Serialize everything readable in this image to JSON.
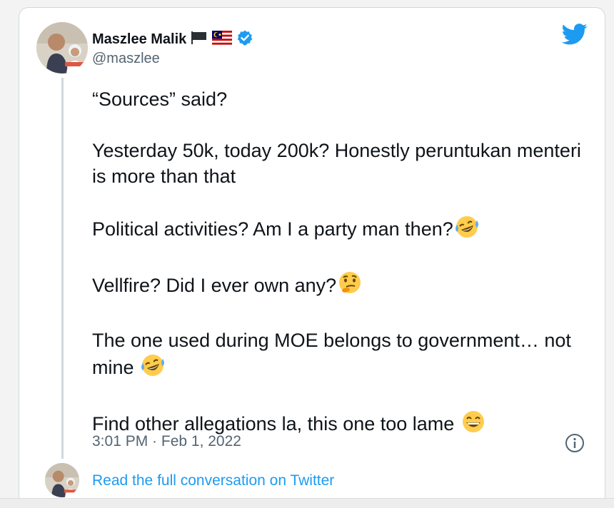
{
  "author": {
    "display_name": "Maszlee Malik",
    "handle": "@maszlee",
    "badges": [
      "black-flag-icon",
      "malaysia-flag-icon",
      "verified-badge-icon"
    ]
  },
  "tweet": {
    "paragraphs": [
      "“Sources” said?",
      "Yesterday 50k, today 200k? Honestly peruntukan menteri is more than that",
      "Political activities? Am I a party man then?",
      "Vellfire? Did I ever own any?",
      "The one used during MOE belongs to government… not mine",
      "Find other allegations la, this one too lame"
    ],
    "timestamp": "3:01 PM · Feb 1, 2022"
  },
  "footer": {
    "read_link": "Read the full conversation on Twitter"
  },
  "colors": {
    "brand": "#1d9bf0",
    "text": "#0f1419",
    "muted": "#536471",
    "border": "#cfd9de"
  }
}
